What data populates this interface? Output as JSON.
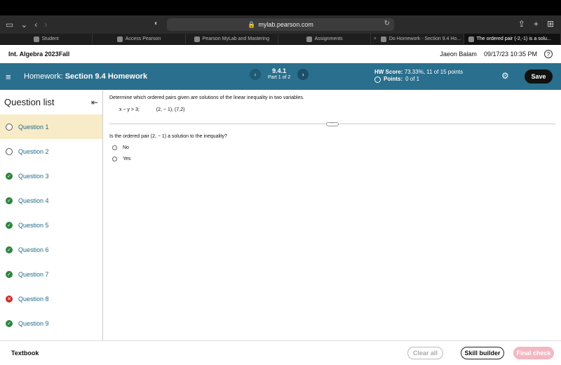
{
  "browser": {
    "url": "mylab.pearson.com",
    "tabs": [
      {
        "label": "Student"
      },
      {
        "label": "Access Pearson"
      },
      {
        "label": "Pearson MyLab and Mastering"
      },
      {
        "label": "Assignments"
      },
      {
        "label": "Do Homework - Section 9.4 Ho..."
      },
      {
        "label": "The ordered pair (-2,-1) is a solu..."
      }
    ]
  },
  "course": {
    "title": "Int. Algebra 2023Fall",
    "user": "Jaeon Balam",
    "datetime": "09/17/23 10:35 PM",
    "help": "?"
  },
  "homework": {
    "prefix": "Homework:",
    "name": "Section 9.4 Homework",
    "question_number": "9.4.1",
    "part": "Part 1 of 2",
    "score_label": "HW Score:",
    "score_value": "73.33%, 11 of 15 points",
    "points_label": "Points:",
    "points_value": "0 of 1",
    "save_label": "Save"
  },
  "sidebar": {
    "title": "Question list",
    "items": [
      {
        "label": "Question 1",
        "status": "empty"
      },
      {
        "label": "Question 2",
        "status": "empty"
      },
      {
        "label": "Question 3",
        "status": "correct"
      },
      {
        "label": "Question 4",
        "status": "correct"
      },
      {
        "label": "Question 5",
        "status": "correct"
      },
      {
        "label": "Question 6",
        "status": "correct"
      },
      {
        "label": "Question 7",
        "status": "correct"
      },
      {
        "label": "Question 8",
        "status": "incorrect"
      },
      {
        "label": "Question 9",
        "status": "correct"
      }
    ]
  },
  "question": {
    "instruction": "Determine which ordered pairs given are solutions of the linear inequality in two variables.",
    "inequality": "x − y > 3;",
    "pairs": "(2, − 1), (7,2)",
    "prompt": "Is the ordered pair (2, − 1) a solution to the inequality?",
    "options": [
      "No",
      "Yes"
    ]
  },
  "footer": {
    "textbook": "Textbook",
    "clear_all": "Clear all",
    "skill_builder": "Skill builder",
    "final_check": "Final check"
  }
}
